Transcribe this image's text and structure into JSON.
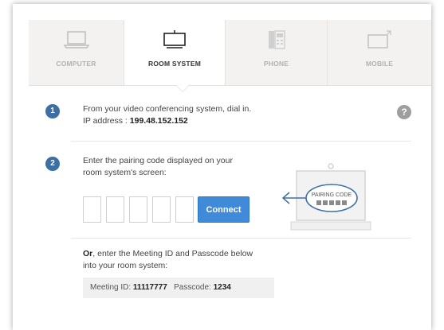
{
  "tabs": [
    {
      "label": "COMPUTER",
      "icon": "laptop-icon",
      "active": false
    },
    {
      "label": "ROOM SYSTEM",
      "icon": "tv-icon",
      "active": true
    },
    {
      "label": "PHONE",
      "icon": "phone-icon",
      "active": false
    },
    {
      "label": "MOBILE",
      "icon": "mobile-icon",
      "active": false
    }
  ],
  "step1": {
    "number": "1",
    "text": "From your video conferencing system, dial in.",
    "ip_label": "IP address : ",
    "ip_value": "199.48.152.152",
    "help": "?"
  },
  "step2": {
    "number": "2",
    "line1": "Enter the pairing code displayed on your",
    "line2": "room system's screen:",
    "connect_label": "Connect",
    "illustration_label": "PAIRING CODE"
  },
  "alt": {
    "or_label": "Or",
    "line1_rest": ", enter the Meeting ID and Passcode below",
    "line2": "into your room system:",
    "meeting_label": "Meeting ID: ",
    "meeting_id": "11117777",
    "passcode_label": "Passcode: ",
    "passcode": "1234"
  },
  "colors": {
    "accent": "#3f8ad9",
    "step_badge": "#3d6fa5",
    "tab_inactive": "#f4f2f1"
  }
}
